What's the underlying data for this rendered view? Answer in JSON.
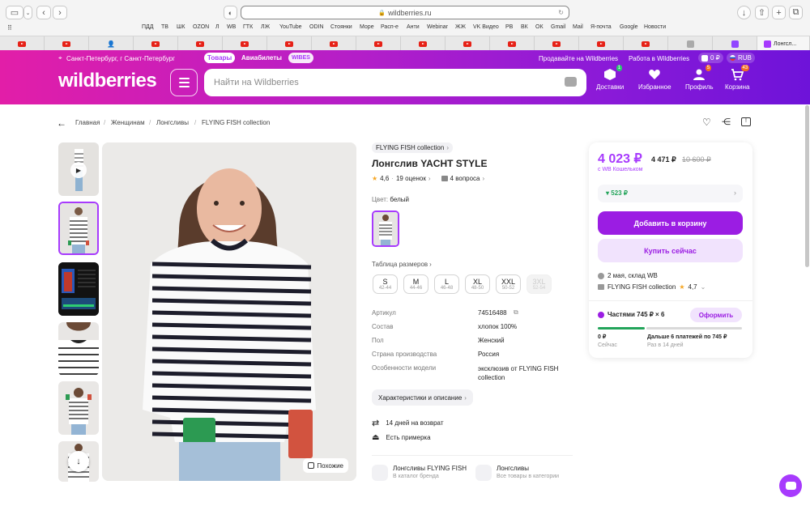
{
  "browser": {
    "url": "wildberries.ru",
    "bookmarks": [
      "ПДД",
      "ТВ",
      "ШК",
      "OZON",
      "Л",
      "WB",
      "ГТК",
      "ЛЖ",
      "YouTube",
      "ODIN",
      "Стоянки",
      "Море",
      "Расп-е",
      "Анти",
      "Webinar",
      "ЖЖ",
      "VK Видео",
      "РВ",
      "ВК",
      "ОК",
      "Gmail",
      "Mail",
      "Я-почта",
      "Google",
      "Новости"
    ],
    "active_tab": "Лонгсл..."
  },
  "header": {
    "location": "Санкт-Петербург, г Санкт-Петербург",
    "tab_goods": "Товары",
    "tab_flights": "Авиабилеты",
    "tab_wibes": "WIBES",
    "sell_link": "Продавайте на Wildberries",
    "work_link": "Работа в Wildberries",
    "balance": "0 ₽",
    "currency": "RUB",
    "logo": "wildberries",
    "search_placeholder": "Найти на Wildberries",
    "nav": {
      "delivery": "Доставки",
      "favorites": "Избранное",
      "profile": "Профиль",
      "cart": "Корзина",
      "delivery_badge": "1",
      "profile_badge": "5",
      "cart_badge": "43"
    }
  },
  "breadcrumbs": [
    "Главная",
    "Женщинам",
    "Лонгсливы",
    "FLYING FISH collection"
  ],
  "product": {
    "brand": "FLYING FISH collection",
    "title": "Лонгслив YACHT STYLE",
    "rating": "4,6",
    "reviews": "19 оценок",
    "questions": "4 вопроса",
    "color_label": "Цвет:",
    "color_value": "белый",
    "size_table": "Таблица размеров",
    "sizes": [
      {
        "name": "S",
        "ru": "42-44"
      },
      {
        "name": "M",
        "ru": "44-46"
      },
      {
        "name": "L",
        "ru": "46-48"
      },
      {
        "name": "XL",
        "ru": "48-50"
      },
      {
        "name": "XXL",
        "ru": "50-52"
      },
      {
        "name": "3XL",
        "ru": "52-54"
      }
    ],
    "specs": [
      {
        "label": "Артикул",
        "value": "74516488"
      },
      {
        "label": "Состав",
        "value": "хлопок 100%"
      },
      {
        "label": "Пол",
        "value": "Женский"
      },
      {
        "label": "Страна производства",
        "value": "Россия"
      },
      {
        "label": "Особенности модели",
        "value": "эксклюзив от FLYING FISH collection"
      }
    ],
    "details_button": "Характеристики и описание",
    "return_text": "14 дней на возврат",
    "fitting_text": "Есть примерка",
    "similar_button": "Похожие",
    "bottom_links": [
      {
        "title": "Лонгсливы FLYING FISH",
        "sub": "В каталог бренда"
      },
      {
        "title": "Лонгсливы",
        "sub": "Все товары в категории"
      }
    ]
  },
  "buy": {
    "price": "4 023 ₽",
    "price_regular": "4 471 ₽",
    "price_old": "10 600 ₽",
    "wallet_note": "с WB Кошельком",
    "cashback": "523 ₽",
    "add_to_cart": "Добавить в корзину",
    "buy_now": "Купить сейчас",
    "delivery": "2 мая, склад WB",
    "seller": "FLYING FISH collection",
    "seller_rating": "4,7",
    "installments": "Частями 745 ₽ × 6",
    "installments_button": "Оформить",
    "pay_now": "0 ₽",
    "pay_now_sub": "Сейчас",
    "pay_later": "Дальше 6 платежей по 745 ₽",
    "pay_later_sub": "Раз в 14 дней"
  },
  "colors": {
    "brand_purple": "#a73afd",
    "button_purple": "#9b1de3",
    "header_pink": "#e21ea8",
    "header_violet": "#6e13d9"
  }
}
